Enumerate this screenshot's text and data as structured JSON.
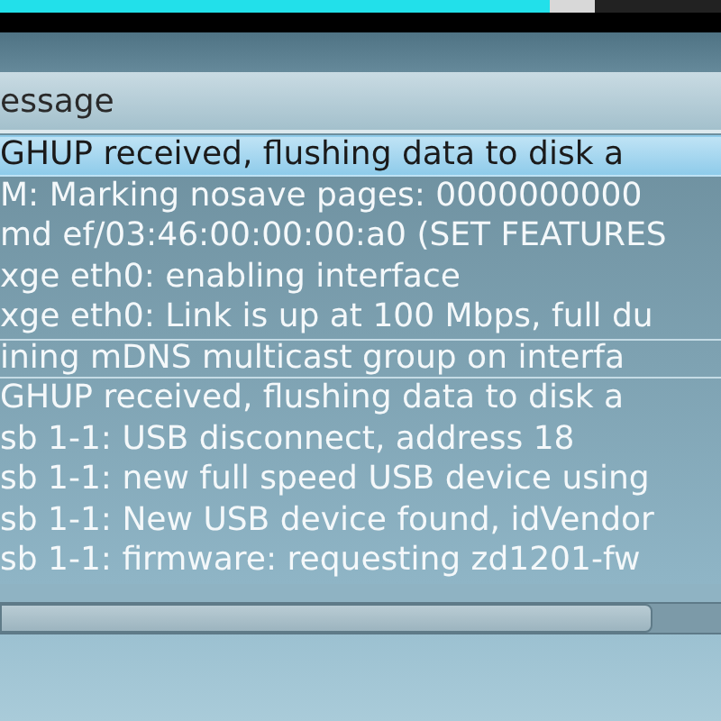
{
  "table": {
    "column_header": "essage",
    "rows": [
      {
        "text": "GHUP received, flushing data to disk a",
        "selected": true,
        "focused": false
      },
      {
        "text": "M: Marking nosave pages: 0000000000",
        "selected": false,
        "focused": false
      },
      {
        "text": "md ef/03:46:00:00:00:a0 (SET FEATURES",
        "selected": false,
        "focused": false
      },
      {
        "text": "xge eth0: enabling interface",
        "selected": false,
        "focused": false
      },
      {
        "text": "xge eth0: Link is up at 100 Mbps, full du",
        "selected": false,
        "focused": false
      },
      {
        "text": "ining mDNS multicast group on interfa",
        "selected": false,
        "focused": true
      },
      {
        "text": "GHUP received, flushing data to disk a",
        "selected": false,
        "focused": false
      },
      {
        "text": "sb 1-1: USB disconnect, address 18",
        "selected": false,
        "focused": false
      },
      {
        "text": "sb 1-1: new full speed USB device using",
        "selected": false,
        "focused": false
      },
      {
        "text": "sb 1-1: New USB device found, idVendor",
        "selected": false,
        "focused": false
      },
      {
        "text": "sb 1-1: firmware: requesting zd1201-fw",
        "selected": false,
        "focused": false
      }
    ]
  }
}
